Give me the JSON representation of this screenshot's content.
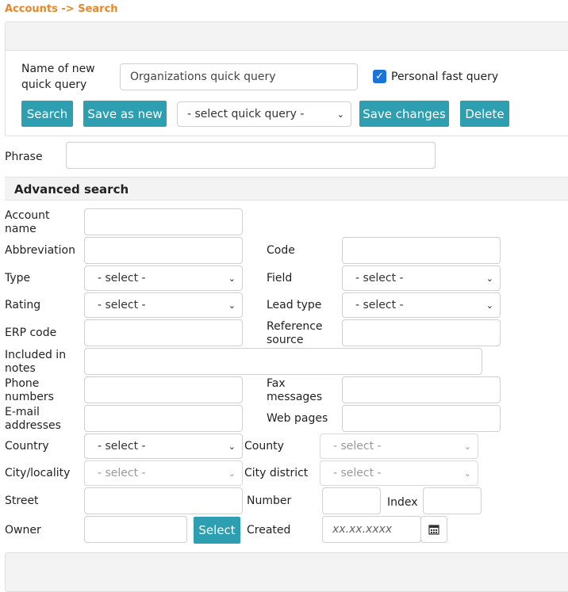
{
  "breadcrumb": "Accounts -> Search",
  "quick_query": {
    "name_label_line1": "Name of new",
    "name_label_line2": "quick query",
    "name_value": "Organizations quick query",
    "personal_label": "Personal fast query",
    "personal_checked": true,
    "search_button": "Search",
    "save_as_new_button": "Save as new",
    "select_placeholder": "- select quick query -",
    "save_changes_button": "Save changes",
    "delete_button": "Delete"
  },
  "phrase_label": "Phrase",
  "advanced_title": "Advanced search",
  "fields": {
    "account_name_l1": "Account",
    "account_name_l2": "name",
    "abbreviation": "Abbreviation",
    "code": "Code",
    "type": "Type",
    "field": "Field",
    "rating": "Rating",
    "lead_type": "Lead type",
    "erp_code": "ERP code",
    "reference_l1": "Reference",
    "reference_l2": "source",
    "included_l1": "Included in",
    "included_l2": "notes",
    "phone_l1": "Phone",
    "phone_l2": "numbers",
    "fax_l1": "Fax",
    "fax_l2": "messages",
    "email_l1": "E-mail",
    "email_l2": "addresses",
    "web_pages": "Web pages",
    "country": "Country",
    "county": "County",
    "city": "City/locality",
    "city_district": "City district",
    "street": "Street",
    "number": "Number",
    "index": "Index",
    "owner": "Owner",
    "owner_select_button": "Select",
    "created": "Created",
    "created_placeholder": "xx.xx.xxxx"
  },
  "select_placeholder": "- select -",
  "icons": {
    "chevron": "chevron-down-icon",
    "calendar": "calendar-icon",
    "checkbox": "checkbox-checked-icon"
  },
  "colors": {
    "accent": "#2e9fb0",
    "breadcrumb": "#e8872a",
    "checkbox": "#1c74d8"
  }
}
